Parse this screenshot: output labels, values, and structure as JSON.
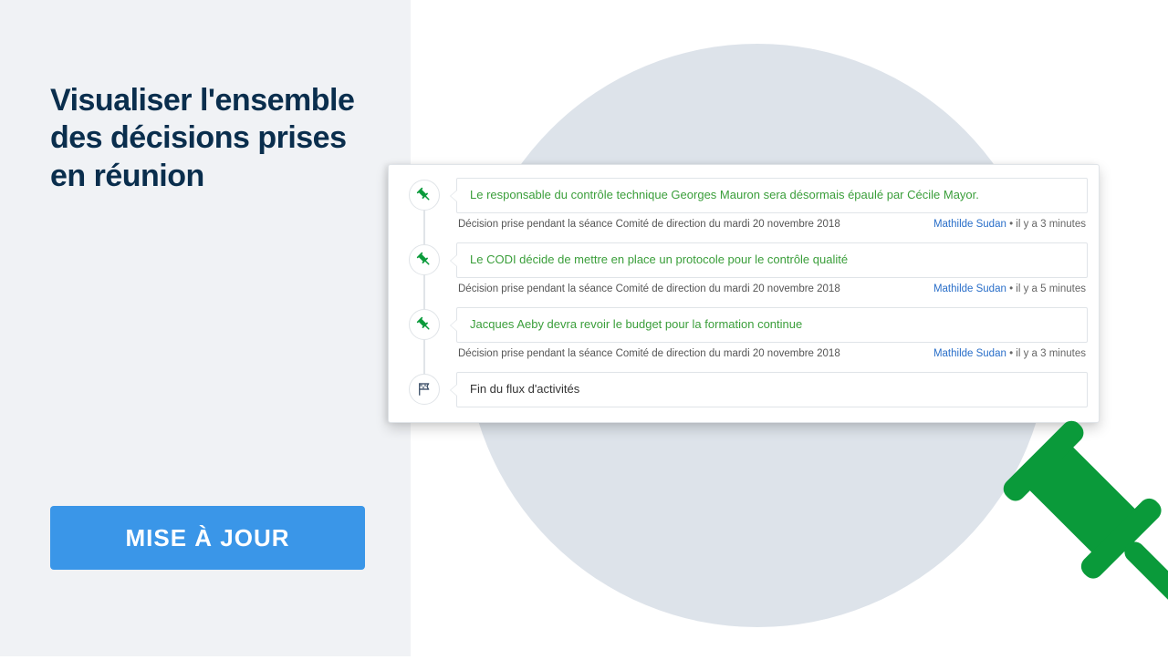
{
  "headline": "Visualiser l'ensemble des décisions prises en réunion",
  "cta": "MISE À JOUR",
  "entries": [
    {
      "title": "Le responsable du contrôle technique Georges Mauron sera désormais épaulé par Cécile Mayor.",
      "context": "Décision prise pendant la séance Comité de direction du mardi 20 novembre 2018",
      "author": "Mathilde Sudan",
      "time": "il y a 3 minutes"
    },
    {
      "title": "Le CODI décide de mettre en place un protocole pour le contrôle qualité",
      "context": "Décision prise pendant la séance Comité de direction du mardi 20 novembre 2018",
      "author": "Mathilde Sudan",
      "time": "il y a 5 minutes"
    },
    {
      "title": "Jacques Aeby devra revoir le budget pour la formation continue",
      "context": "Décision prise pendant la séance Comité de direction du mardi 20 novembre 2018",
      "author": "Mathilde Sudan",
      "time": "il y a 3 minutes"
    }
  ],
  "end_of_feed": "Fin du flux d'activités"
}
